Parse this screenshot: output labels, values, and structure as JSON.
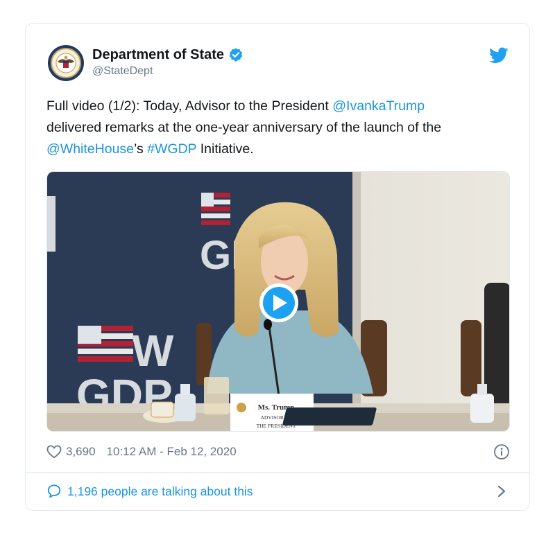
{
  "tweet": {
    "display_name": "Department of State",
    "handle": "@StateDept",
    "avatar_icon": "department-of-state-seal",
    "verified_icon": "verified-badge-icon",
    "platform_icon": "twitter-bird-icon",
    "text_segments": [
      {
        "text": "Full video (1/2): Today, Advisor to the President ",
        "link": false
      },
      {
        "text": "@IvankaTrump",
        "link": true
      },
      {
        "text": " delivered remarks at the one-year anniversary of the launch of the ",
        "link": false
      },
      {
        "text": "@WhiteHouse",
        "link": true
      },
      {
        "text": "’s ",
        "link": false
      },
      {
        "text": "#WGDP",
        "link": true
      },
      {
        "text": " Initiative.",
        "link": false
      }
    ],
    "media": {
      "type": "video",
      "play_icon": "play-button-icon",
      "banner_top": "GD",
      "banner_bottom_w": "W",
      "banner_bottom": "GDP",
      "placard_line1": "Ms. Trump",
      "placard_line2": "ADVISOR TO",
      "placard_line3": "THE PRESIDENT"
    },
    "likes": "3,690",
    "timestamp": "10:12 AM - Feb 12, 2020",
    "talking": "1,196 people are talking about this"
  },
  "colors": {
    "link": "#1b95e0",
    "secondary": "#657786",
    "border": "#e1e8ed",
    "banner_navy": "#2b3b55"
  }
}
